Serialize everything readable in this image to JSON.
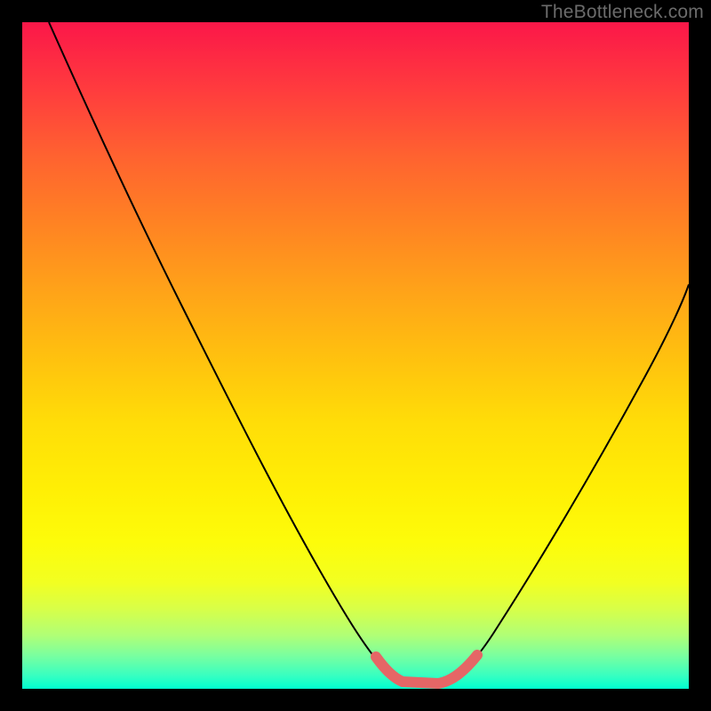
{
  "watermark": "TheBottleneck.com",
  "chart_data": {
    "type": "line",
    "title": "",
    "xlabel": "",
    "ylabel": "",
    "xlim": [
      0,
      100
    ],
    "ylim": [
      0,
      100
    ],
    "grid": false,
    "legend": false,
    "series": [
      {
        "name": "bottleneck-curve",
        "description": "V-shaped curve; left branch steep from top-left to trough, short flat trough near bottom, right branch rising to mid-right",
        "x": [
          4,
          10,
          18,
          26,
          34,
          42,
          50,
          54,
          58,
          60,
          62,
          66,
          70,
          78,
          86,
          94,
          100
        ],
        "values": [
          100,
          89,
          76,
          62,
          48,
          34,
          18,
          10,
          4,
          2,
          2,
          3,
          6,
          14,
          26,
          40,
          52
        ]
      },
      {
        "name": "optimal-range-highlight",
        "description": "Thick pink segment covering the trough of the V curve",
        "x": [
          54,
          56,
          58,
          60,
          62,
          64,
          66,
          68,
          70
        ],
        "values": [
          9,
          6,
          3.5,
          2.2,
          1.8,
          2.0,
          2.8,
          4.2,
          6.8
        ]
      }
    ],
    "background": {
      "gradient": "red-top-to-green-bottom",
      "stops": [
        "#fb1749",
        "#ff6230",
        "#ffc00f",
        "#fdfc0a",
        "#7aff9f",
        "#00ffcf"
      ]
    }
  }
}
